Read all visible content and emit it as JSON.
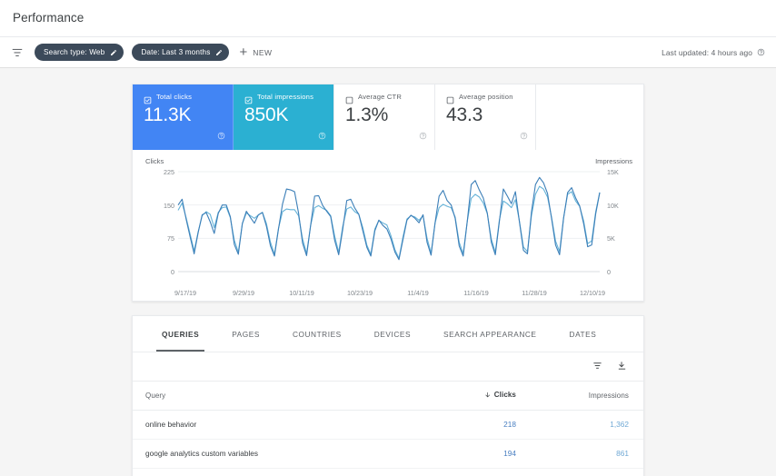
{
  "header": {
    "title": "Performance"
  },
  "filterbar": {
    "filter_icon": "filter-list-icon",
    "chips": [
      {
        "label": "Search type: Web",
        "edit_icon": "pencil-icon"
      },
      {
        "label": "Date: Last 3 months",
        "edit_icon": "pencil-icon"
      }
    ],
    "new_button": {
      "plus": "+",
      "label": "NEW"
    },
    "last_updated": "Last updated: 4 hours ago",
    "help_icon": "help-circle-icon"
  },
  "metrics": [
    {
      "label": "Total clicks",
      "value": "11.3K",
      "selected": true,
      "color": "#4285f4",
      "checkbox_icon": "checkbox-checked-icon",
      "help_icon": "help-circle-icon"
    },
    {
      "label": "Total impressions",
      "value": "850K",
      "selected": true,
      "color": "#2bb0d2",
      "checkbox_icon": "checkbox-checked-icon",
      "help_icon": "help-circle-icon"
    },
    {
      "label": "Average CTR",
      "value": "1.3%",
      "selected": false,
      "color": "#ffffff",
      "checkbox_icon": "checkbox-unchecked-icon",
      "help_icon": "help-circle-icon"
    },
    {
      "label": "Average position",
      "value": "43.3",
      "selected": false,
      "color": "#ffffff",
      "checkbox_icon": "checkbox-unchecked-icon",
      "help_icon": "help-circle-icon"
    }
  ],
  "chart_data": {
    "type": "line",
    "title": "",
    "xlabel": "",
    "y_left_label": "Clicks",
    "y_right_label": "Impressions",
    "y_left_ticks": [
      "225",
      "150",
      "75",
      "0"
    ],
    "y_right_ticks": [
      "15K",
      "10K",
      "5K",
      "0"
    ],
    "ylim_left": [
      0,
      225
    ],
    "ylim_right": [
      0,
      15000
    ],
    "grid": true,
    "legend": "none",
    "x_tick_labels": [
      "9/17/19",
      "9/29/19",
      "10/11/19",
      "10/23/19",
      "11/4/19",
      "11/16/19",
      "11/28/19",
      "12/10/19"
    ],
    "series": [
      {
        "name": "Clicks",
        "color": "#3c7fb8",
        "axis": "left",
        "values": [
          150,
          163,
          118,
          78,
          40,
          88,
          128,
          133,
          112,
          86,
          131,
          150,
          150,
          124,
          61,
          39,
          108,
          136,
          122,
          109,
          128,
          133,
          102,
          58,
          35,
          96,
          152,
          186,
          184,
          180,
          132,
          64,
          36,
          104,
          170,
          171,
          149,
          136,
          124,
          70,
          38,
          95,
          160,
          163,
          143,
          129,
          92,
          55,
          35,
          92,
          116,
          104,
          96,
          74,
          44,
          27,
          72,
          116,
          127,
          120,
          110,
          128,
          66,
          37,
          110,
          170,
          183,
          160,
          150,
          120,
          58,
          35,
          112,
          196,
          205,
          184,
          166,
          132,
          66,
          38,
          112,
          186,
          170,
          153,
          180,
          112,
          48,
          40,
          134,
          196,
          212,
          200,
          176,
          120,
          60,
          38,
          120,
          178,
          189,
          166,
          148,
          108,
          56,
          60,
          130,
          178
        ]
      },
      {
        "name": "Impressions",
        "color": "#66b3d8",
        "axis": "right",
        "values": [
          9200,
          10300,
          8100,
          5600,
          3100,
          6000,
          8400,
          9000,
          8600,
          6600,
          8900,
          9600,
          9700,
          8100,
          4700,
          2900,
          7200,
          8800,
          8400,
          8000,
          8500,
          8900,
          7200,
          4400,
          2600,
          6500,
          9000,
          9400,
          9300,
          9300,
          8400,
          4900,
          2700,
          6900,
          9600,
          9900,
          9500,
          9200,
          8400,
          5300,
          2900,
          6800,
          9400,
          9700,
          9000,
          8600,
          6600,
          4000,
          2600,
          6400,
          7700,
          7300,
          7000,
          5400,
          3300,
          2000,
          5200,
          7900,
          8400,
          8200,
          7700,
          8400,
          5000,
          2800,
          7300,
          9600,
          10100,
          9800,
          9600,
          8200,
          4400,
          2700,
          7500,
          11000,
          11600,
          11200,
          10300,
          8700,
          4900,
          2900,
          7700,
          10600,
          10200,
          9600,
          10800,
          7600,
          3700,
          3000,
          8400,
          11600,
          12800,
          12400,
          11200,
          8200,
          4600,
          3000,
          8100,
          11600,
          12000,
          10600,
          9800,
          7600,
          4200,
          4600,
          9000,
          11900
        ]
      }
    ]
  },
  "table": {
    "tabs": [
      {
        "label": "QUERIES",
        "active": true
      },
      {
        "label": "PAGES",
        "active": false
      },
      {
        "label": "COUNTRIES",
        "active": false
      },
      {
        "label": "DEVICES",
        "active": false
      },
      {
        "label": "SEARCH APPEARANCE",
        "active": false
      },
      {
        "label": "DATES",
        "active": false
      }
    ],
    "tools": [
      {
        "icon": "filter-list-icon",
        "name": "filter-button"
      },
      {
        "icon": "download-icon",
        "name": "export-button"
      }
    ],
    "columns": [
      "Query",
      "Clicks",
      "Impressions"
    ],
    "sort_column": "Clicks",
    "sort_direction": "desc",
    "rows": [
      {
        "query": "online behavior",
        "clicks": "218",
        "impressions": "1,362"
      },
      {
        "query": "google analytics custom variables",
        "clicks": "194",
        "impressions": "861"
      }
    ]
  }
}
